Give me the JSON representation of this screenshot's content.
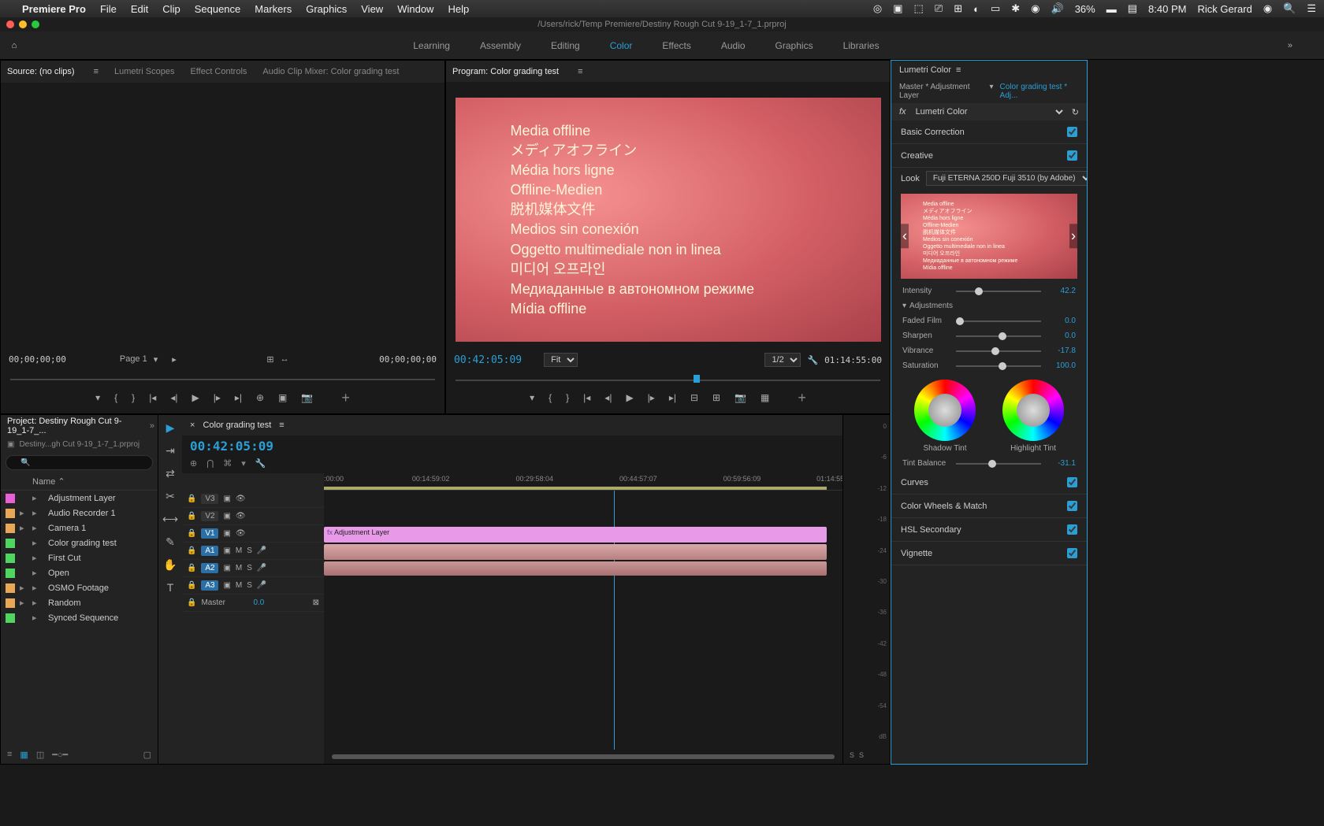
{
  "macMenu": {
    "appName": "Premiere Pro",
    "items": [
      "File",
      "Edit",
      "Clip",
      "Sequence",
      "Markers",
      "Graphics",
      "View",
      "Window",
      "Help"
    ],
    "battery": "36%",
    "time": "8:40 PM",
    "user": "Rick Gerard"
  },
  "titlebar": "/Users/rick/Temp Premiere/Destiny Rough Cut 9-19_1-7_1.prproj",
  "workspaces": [
    "Learning",
    "Assembly",
    "Editing",
    "Color",
    "Effects",
    "Audio",
    "Graphics",
    "Libraries"
  ],
  "workspaceActive": "Color",
  "sourceTabs": [
    "Source: (no clips)",
    "Lumetri Scopes",
    "Effect Controls",
    "Audio Clip Mixer: Color grading test"
  ],
  "programTab": "Program: Color grading test",
  "mediaOffline": [
    "Media offline",
    "メディアオフライン",
    "Média hors ligne",
    "Offline-Medien",
    "脱机媒体文件",
    "Medios sin conexión",
    "Oggetto multimediale non in linea",
    "미디어 오프라인",
    "Медиаданные в автономном режиме",
    "Mídia offline"
  ],
  "sourceTC": "00;00;00;00",
  "sourcePage": "Page 1",
  "programTC": "00:42:05:09",
  "programDur": "01:14:55:00",
  "programFit": "Fit",
  "programRes": "1/2",
  "project": {
    "panelTitle": "Project: Destiny Rough Cut 9-19_1-7_...",
    "file": "Destiny...gh Cut 9-19_1-7_1.prproj",
    "nameHeader": "Name",
    "items": [
      {
        "color": "#e85fd6",
        "name": "Adjustment Layer",
        "expandable": false
      },
      {
        "color": "#e8a657",
        "name": "Audio Recorder 1",
        "expandable": true
      },
      {
        "color": "#e8a657",
        "name": "Camera 1",
        "expandable": true
      },
      {
        "color": "#4fd65f",
        "name": "Color grading test",
        "expandable": false
      },
      {
        "color": "#4fd65f",
        "name": "First Cut",
        "expandable": false
      },
      {
        "color": "#4fd65f",
        "name": "Open",
        "expandable": false
      },
      {
        "color": "#e8a657",
        "name": "OSMO Footage",
        "expandable": true
      },
      {
        "color": "#e8a657",
        "name": "Random",
        "expandable": true
      },
      {
        "color": "#4fd65f",
        "name": "Synced Sequence",
        "expandable": false
      }
    ]
  },
  "timeline": {
    "seqName": "Color grading test",
    "tc": "00:42:05:09",
    "ruler": [
      ":00:00",
      "00:14:59:02",
      "00:29:58:04",
      "00:44:57:07",
      "00:59:56:09",
      "01:14:55:"
    ],
    "playheadPct": 56,
    "tracks": {
      "v3": "V3",
      "v2": "V2",
      "v1": "V1",
      "a1": "A1",
      "a2": "A2",
      "a3": "A3",
      "master": "Master"
    },
    "adjClip": "Adjustment Layer",
    "masterVal": "0.0"
  },
  "meters": [
    "0",
    "-6",
    "-12",
    "-18",
    "-24",
    "-30",
    "-36",
    "-42",
    "-48",
    "-54",
    "dB"
  ],
  "lumetri": {
    "title": "Lumetri Color",
    "breadcrumbMaster": "Master * Adjustment Layer",
    "breadcrumbSeq": "Color grading test * Adj...",
    "fxName": "Lumetri Color",
    "sections": {
      "basic": "Basic Correction",
      "creative": "Creative",
      "curves": "Curves",
      "cwm": "Color Wheels & Match",
      "hsl": "HSL Secondary",
      "vignette": "Vignette"
    },
    "lookLabel": "Look",
    "lookValue": "Fuji ETERNA 250D Fuji 3510 (by Adobe)",
    "intensity": {
      "label": "Intensity",
      "val": "42.2",
      "pct": 22
    },
    "adjustments": "Adjustments",
    "faded": {
      "label": "Faded Film",
      "val": "0.0",
      "pct": 0
    },
    "sharpen": {
      "label": "Sharpen",
      "val": "0.0",
      "pct": 50
    },
    "vibrance": {
      "label": "Vibrance",
      "val": "-17.8",
      "pct": 42
    },
    "saturation": {
      "label": "Saturation",
      "val": "100.0",
      "pct": 50
    },
    "shadowTint": "Shadow Tint",
    "highlightTint": "Highlight Tint",
    "tintBalance": {
      "label": "Tint Balance",
      "val": "-31.1",
      "pct": 38
    }
  }
}
